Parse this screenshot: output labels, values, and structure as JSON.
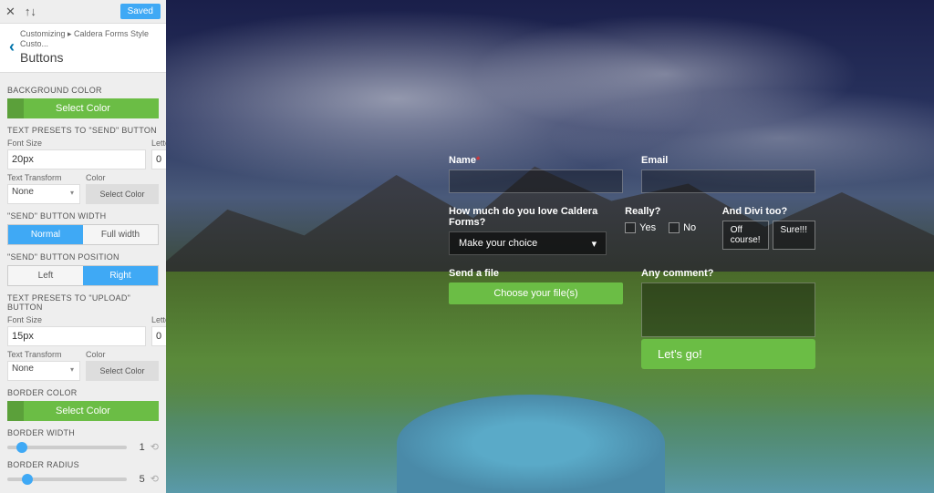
{
  "colors": {
    "accent_green": "#6bbd45",
    "accent_blue": "#3fa9f5"
  },
  "topbar": {
    "saved_label": "Saved"
  },
  "breadcrumb": {
    "path": "Customizing ▸ Caldera Forms Style Custo...",
    "title": "Buttons"
  },
  "sidebar": {
    "bg_color_heading": "BACKGROUND COLOR",
    "select_color_label": "Select Color",
    "send_presets_heading": "TEXT PRESETS TO \"SEND\" BUTTON",
    "font_size_label": "Font Size",
    "font_size_value_send": "20px",
    "letter_spacing_label": "Letter Spacing",
    "letter_spacing_value": "0",
    "text_transform_label": "Text Transform",
    "text_transform_value": "None",
    "color_label": "Color",
    "mini_select_color": "Select Color",
    "send_width_heading": "\"SEND\" BUTTON WIDTH",
    "width_normal": "Normal",
    "width_full": "Full width",
    "send_position_heading": "\"SEND\" BUTTON POSITION",
    "pos_left": "Left",
    "pos_right": "Right",
    "upload_presets_heading": "TEXT PRESETS TO \"UPLOAD\" BUTTON",
    "font_size_value_upload": "15px",
    "border_color_heading": "BORDER COLOR",
    "border_width_heading": "BORDER WIDTH",
    "border_width_value": "1",
    "border_radius_heading": "BORDER RADIUS",
    "border_radius_value": "5"
  },
  "form": {
    "name_label": "Name",
    "email_label": "Email",
    "love_label": "How much do you love Caldera Forms?",
    "love_placeholder": "Make your choice",
    "really_label": "Really?",
    "yes": "Yes",
    "no": "No",
    "divi_label": "And Divi too?",
    "pill_off": "Off course!",
    "pill_sure": "Sure!!!",
    "send_file_label": "Send a file",
    "choose_file": "Choose your file(s)",
    "comment_label": "Any comment?",
    "submit": "Let's go!"
  }
}
